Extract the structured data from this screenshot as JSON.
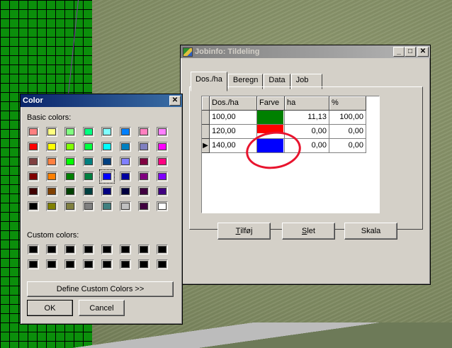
{
  "color_dialog": {
    "title": "Color",
    "close_glyph": "✕",
    "basic_colors_label": "Basic colors:",
    "custom_colors_label": "Custom colors:",
    "define_button": "Define Custom Colors >>",
    "ok_button": "OK",
    "cancel_button": "Cancel",
    "basic_colors": [
      [
        "#ff8080",
        "#ffff80",
        "#80ff80",
        "#00ff80",
        "#80ffff",
        "#0080ff",
        "#ff80c0",
        "#ff80ff"
      ],
      [
        "#ff0000",
        "#ffff00",
        "#80ff00",
        "#00ff40",
        "#00ffff",
        "#0080c0",
        "#8080c0",
        "#ff00ff"
      ],
      [
        "#804040",
        "#ff8040",
        "#00ff00",
        "#008080",
        "#004080",
        "#8080ff",
        "#800040",
        "#ff0080"
      ],
      [
        "#800000",
        "#ff8000",
        "#008000",
        "#008040",
        "#0000ff",
        "#0000a0",
        "#800080",
        "#8000ff"
      ],
      [
        "#400000",
        "#804000",
        "#004000",
        "#004040",
        "#000080",
        "#000040",
        "#400040",
        "#400080"
      ],
      [
        "#000000",
        "#808000",
        "#808040",
        "#808080",
        "#408080",
        "#c0c0c0",
        "#400040",
        "#ffffff"
      ]
    ],
    "selected": {
      "row": 3,
      "col": 4
    },
    "custom_colors": [
      "#000000",
      "#000000",
      "#000000",
      "#000000",
      "#000000",
      "#000000",
      "#000000",
      "#000000",
      "#000000",
      "#000000",
      "#000000",
      "#000000",
      "#000000",
      "#000000",
      "#000000",
      "#000000"
    ]
  },
  "job_window": {
    "title": "Jobinfo: Tildeling",
    "minimize_glyph": "_",
    "maximize_glyph": "□",
    "close_glyph": "✕",
    "tabs": [
      "Dos./ha",
      "Beregn",
      "Data",
      "Job"
    ],
    "active_tab": 0,
    "columns": [
      "Dos./ha",
      "Farve",
      "ha",
      "%"
    ],
    "rows": [
      {
        "dos": "100,00",
        "farve": "#008000",
        "ha": "11,13",
        "pct": "100,00"
      },
      {
        "dos": "120,00",
        "farve": "#ff0000",
        "ha": "0,00",
        "pct": "0,00"
      },
      {
        "dos": "140,00",
        "farve": "#0000ff",
        "ha": "0,00",
        "pct": "0,00"
      }
    ],
    "current_row": 2,
    "current_row_marker": "▶",
    "buttons": {
      "tilfoj": {
        "label": "Tilføj",
        "underline": "T",
        "rest": "ilføj"
      },
      "slet": {
        "label": "Slet",
        "underline": "S",
        "rest": "let"
      },
      "skala": {
        "label": "Skala"
      }
    }
  },
  "colors": {
    "title_active": "#0a246a",
    "field_green": "#0b8f0b",
    "annotation_red": "#e8142e"
  }
}
